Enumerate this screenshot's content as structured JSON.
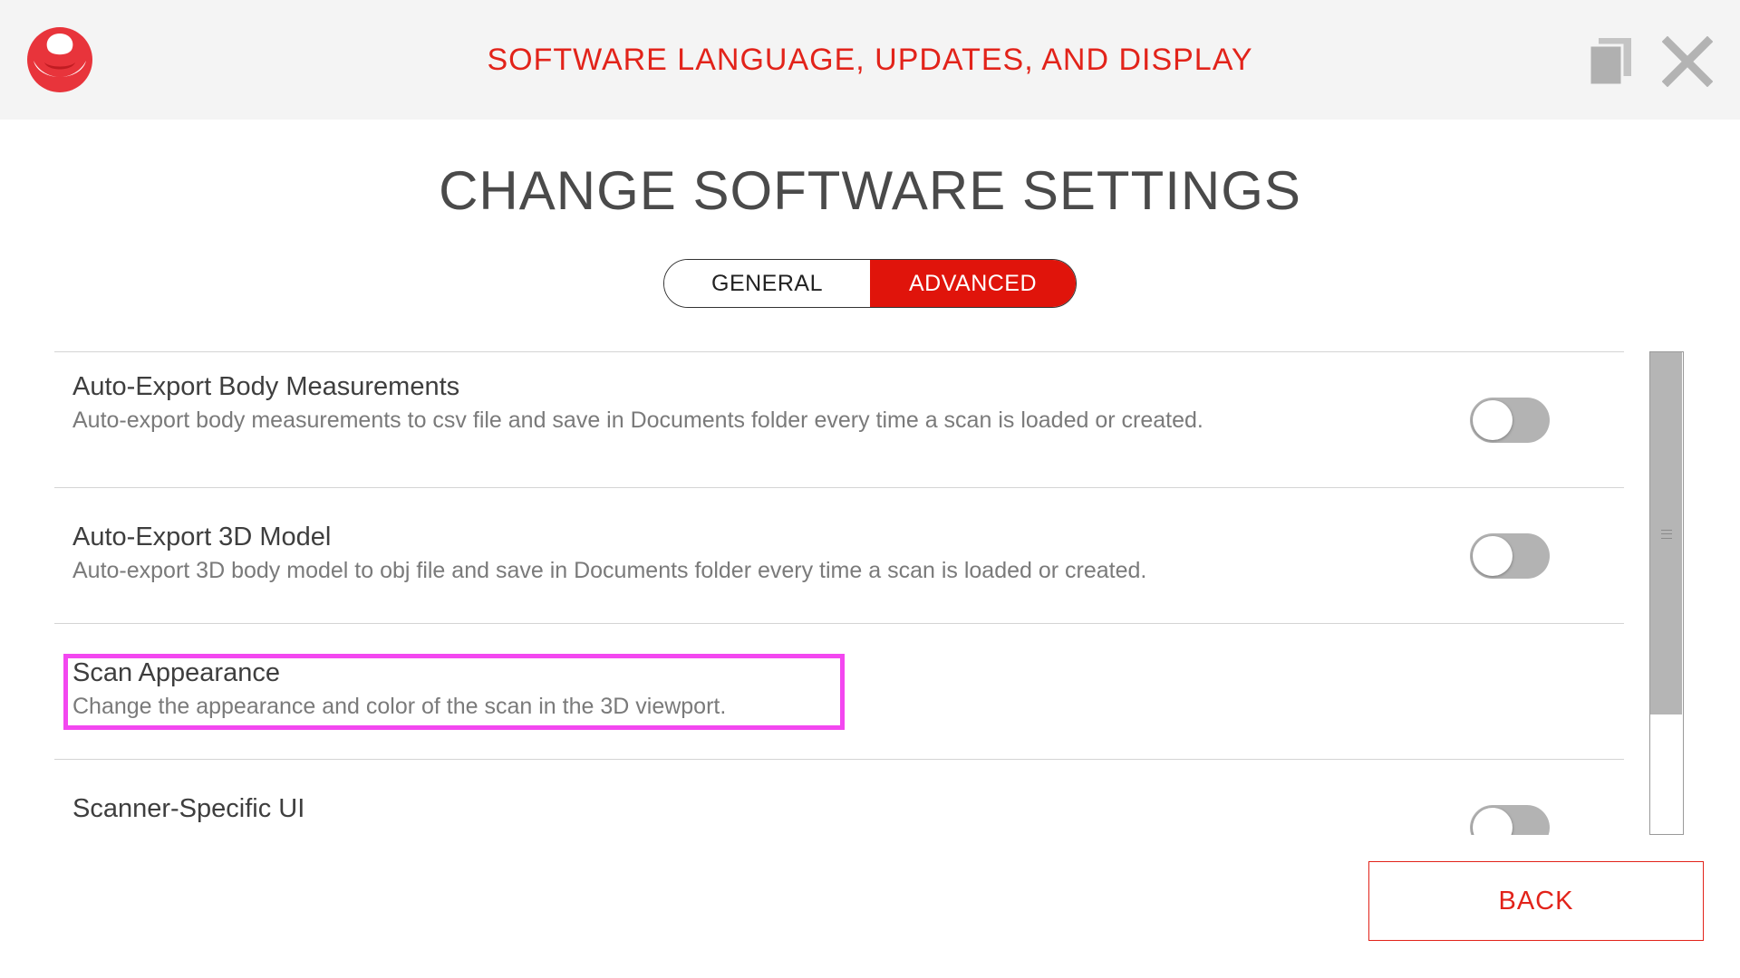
{
  "header": {
    "title": "SOFTWARE LANGUAGE, UPDATES, AND DISPLAY",
    "logo_icon": "brand-logo-icon",
    "copy_icon": "copy-icon",
    "close_icon": "close-icon",
    "accent_color": "#e2231a"
  },
  "main": {
    "title": "CHANGE SOFTWARE SETTINGS",
    "tabs": [
      {
        "label": "GENERAL",
        "active": false
      },
      {
        "label": "ADVANCED",
        "active": true
      }
    ]
  },
  "settings": [
    {
      "title": "Auto-Export Body Measurements",
      "description": "Auto-export body measurements to csv file and save in Documents folder every time a scan is loaded or created.",
      "has_toggle": true,
      "toggle_on": false
    },
    {
      "title": "Auto-Export 3D Model",
      "description": "Auto-export 3D body model to obj file and save in Documents folder every time a scan is loaded or created.",
      "has_toggle": true,
      "toggle_on": false
    },
    {
      "title": "Scan Appearance",
      "description": "Change the appearance and color of the scan in the 3D viewport.",
      "has_toggle": false,
      "highlighted": true
    },
    {
      "title": "Scanner-Specific UI",
      "description": "",
      "has_toggle": true,
      "toggle_on": false
    }
  ],
  "footer": {
    "back_label": "BACK"
  }
}
